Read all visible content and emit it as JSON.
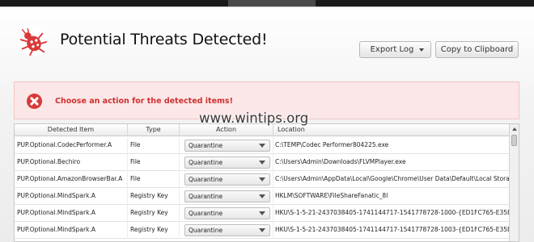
{
  "header": {
    "title": "Potential Threats Detected!",
    "icon": "bug-icon",
    "icon_color": "#d9393a"
  },
  "toolbar": {
    "export_label": "Export Log",
    "copy_label": "Copy to Clipboard"
  },
  "alert": {
    "message": "Choose an action for the detected items!",
    "icon": "error-circle-icon",
    "color": "#d03030"
  },
  "table": {
    "columns": [
      "Detected Item",
      "Type",
      "Action",
      "Location"
    ],
    "rows": [
      {
        "item": "PUP.Optional.CodecPerformer.A",
        "type": "File",
        "action": "Quarantine",
        "location": "C:\\TEMP\\Codec Performer804225.exe"
      },
      {
        "item": "PUP.Optional.Bechiro",
        "type": "File",
        "action": "Quarantine",
        "location": "C:\\Users\\Admin\\Downloads\\FLVMPlayer.exe"
      },
      {
        "item": "PUP.Optional.AmazonBrowserBar.A",
        "type": "File",
        "action": "Quarantine",
        "location": "C:\\Users\\Admin\\AppData\\Local\\Google\\Chrome\\User Data\\Default\\Local Stora..."
      },
      {
        "item": "PUP.Optional.MindSpark.A",
        "type": "Registry Key",
        "action": "Quarantine",
        "location": "HKLM\\SOFTWARE\\FileShareFanatic_8l"
      },
      {
        "item": "PUP.Optional.MindSpark.A",
        "type": "Registry Key",
        "action": "Quarantine",
        "location": "HKU\\S-1-5-21-2437038405-1741144717-1541778728-1000-{ED1FC765-E35E-..."
      },
      {
        "item": "PUP.Optional.MindSpark.A",
        "type": "Registry Key",
        "action": "Quarantine",
        "location": "HKU\\S-1-5-21-2437038405-1741144717-1541778728-1003-{ED1FC765-E35E-..."
      }
    ]
  },
  "watermark": "www.wintips.org"
}
